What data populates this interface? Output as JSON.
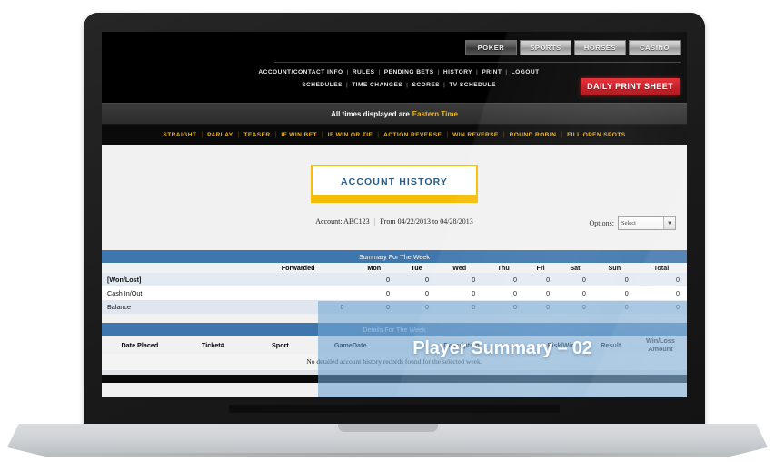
{
  "site": {
    "top_tabs": [
      "POKER",
      "SPORTS",
      "HORSES",
      "CASINO"
    ],
    "menu_row_1": [
      "ACCOUNT/CONTACT INFO",
      "RULES",
      "PENDING BETS",
      "HISTORY",
      "PRINT",
      "LOGOUT"
    ],
    "menu_row_1_active": "HISTORY",
    "menu_row_2": [
      "SCHEDULES",
      "TIME CHANGES",
      "SCORES",
      "TV SCHEDULE"
    ],
    "daily_print_sheet": "DAILY PRINT SHEET",
    "time_notice_prefix": "All times displayed are",
    "time_notice_zone": "Eastern Time",
    "bet_types": [
      "STRAIGHT",
      "PARLAY",
      "TEASER",
      "IF WIN BET",
      "IF WIN OR TIE",
      "ACTION REVERSE",
      "WIN REVERSE",
      "ROUND ROBIN",
      "FILL OPEN SPOTS"
    ],
    "accent_yellow": "#f0b41e",
    "accent_red": "#c20f18",
    "accent_blue": "#3f76ad",
    "title_gold": "#f5bd05"
  },
  "page": {
    "title": "ACCOUNT HISTORY",
    "account_label": "Account:",
    "account_value": "ABC123",
    "date_range_label": "From",
    "date_from": "04/22/2013",
    "date_to_label": "to",
    "date_to": "04/28/2013",
    "options_label": "Options:",
    "options_selected": "Select",
    "options_arrow": "▼"
  },
  "summary": {
    "group_header": "Summary For The Week",
    "columns": [
      "",
      "Forwarded",
      "Mon",
      "Tue",
      "Wed",
      "Thu",
      "Fri",
      "Sat",
      "Sun",
      "Total"
    ],
    "rows": [
      {
        "label": "[Won/Lost]",
        "values": [
          "",
          "0",
          "0",
          "0",
          "0",
          "0",
          "0",
          "0",
          "0"
        ]
      },
      {
        "label": "Cash In/Out",
        "values": [
          "",
          "0",
          "0",
          "0",
          "0",
          "0",
          "0",
          "0",
          "0"
        ]
      },
      {
        "label": "Balance",
        "values": [
          "0",
          "0",
          "0",
          "0",
          "0",
          "0",
          "0",
          "0",
          "0"
        ]
      }
    ]
  },
  "details": {
    "group_header": "Details For The Week",
    "columns": [
      "Date Placed",
      "Ticket#",
      "Sport",
      "GameDate",
      "Description",
      "Risk/Win",
      "Result",
      "Win/Loss\nAmount"
    ],
    "empty_message": "No detailed account history records found for the selected week."
  },
  "overlay": {
    "caption": "Player Summary – 02"
  }
}
